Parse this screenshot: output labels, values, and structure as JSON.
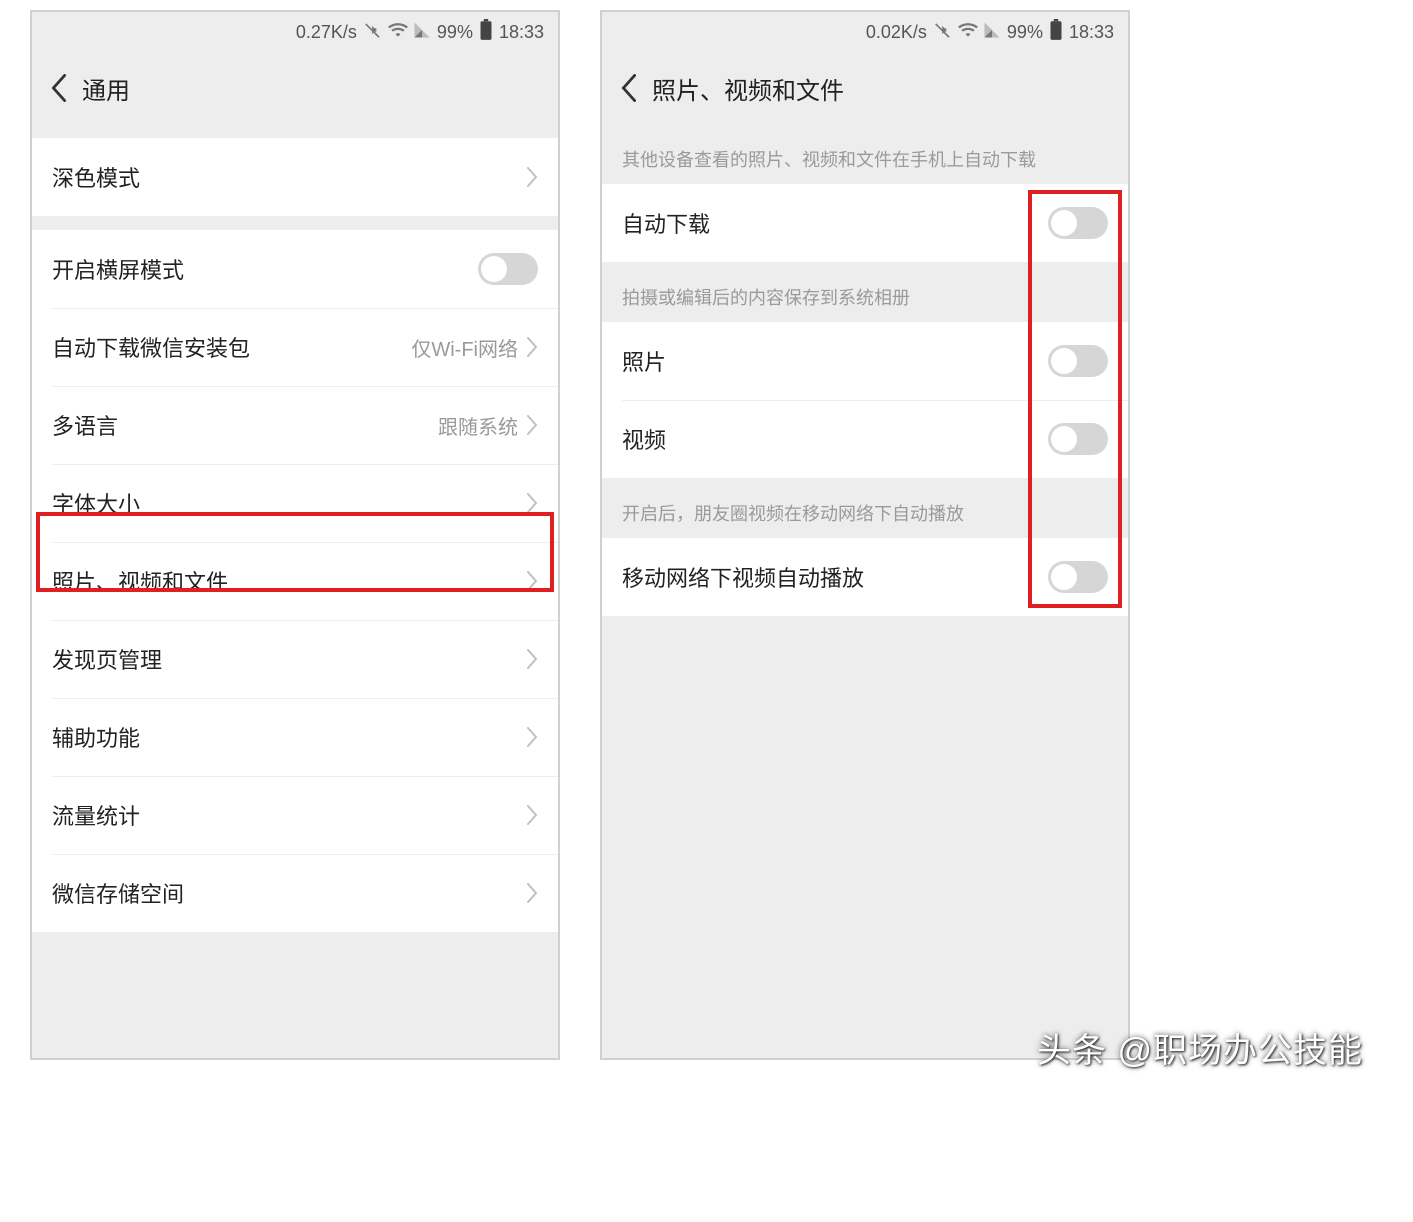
{
  "watermark": "头条 @职场办公技能",
  "left": {
    "status": {
      "net": "0.27K/s",
      "battery": "99%",
      "time": "18:33"
    },
    "title": "通用",
    "rows": {
      "dark_mode": "深色模式",
      "landscape": "开启横屏模式",
      "auto_download_pkg": "自动下载微信安装包",
      "auto_download_pkg_val": "仅Wi-Fi网络",
      "language": "多语言",
      "language_val": "跟随系统",
      "font_size": "字体大小",
      "media_files": "照片、视频和文件",
      "discover": "发现页管理",
      "accessibility": "辅助功能",
      "data_usage": "流量统计",
      "storage": "微信存储空间"
    }
  },
  "right": {
    "status": {
      "net": "0.02K/s",
      "battery": "99%",
      "time": "18:33"
    },
    "title": "照片、视频和文件",
    "desc1": "其他设备查看的照片、视频和文件在手机上自动下载",
    "desc2": "拍摄或编辑后的内容保存到系统相册",
    "desc3": "开启后，朋友圈视频在移动网络下自动播放",
    "rows": {
      "auto_download": "自动下载",
      "photo": "照片",
      "video": "视频",
      "mobile_autoplay": "移动网络下视频自动播放"
    }
  }
}
